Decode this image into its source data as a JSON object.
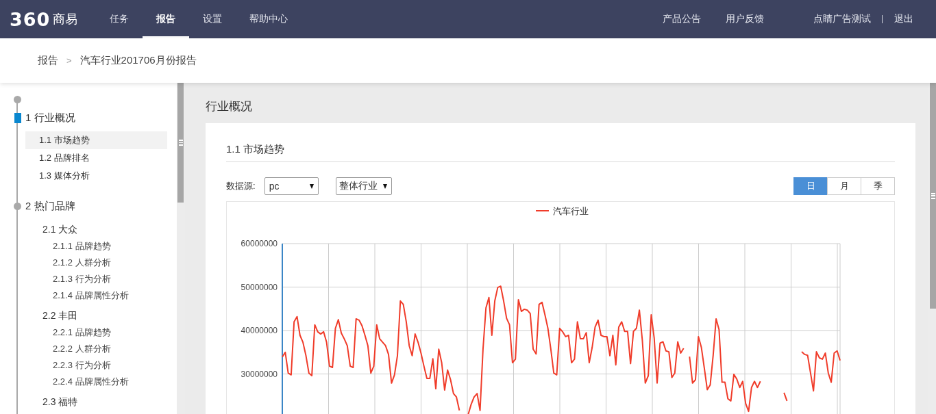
{
  "header": {
    "logo": {
      "mark": "360",
      "name": "商易"
    },
    "tabs": [
      {
        "label": "任务",
        "selected": false
      },
      {
        "label": "报告",
        "selected": true
      },
      {
        "label": "设置",
        "selected": false
      },
      {
        "label": "帮助中心",
        "selected": false
      }
    ],
    "links": [
      "产品公告",
      "用户反馈"
    ],
    "user": "点睛广告测试",
    "logout": "退出"
  },
  "breadcrumb": {
    "items": [
      "报告",
      "汽车行业201706月份报告"
    ],
    "separator": ">"
  },
  "outline": [
    {
      "label": "1 行业概况",
      "current": true,
      "children": [
        {
          "label": "1.1 市场趋势",
          "kind": "page",
          "selected": true
        },
        {
          "label": "1.2 品牌排名",
          "kind": "page",
          "selected": false
        },
        {
          "label": "1.3 媒体分析",
          "kind": "page",
          "selected": false
        }
      ]
    },
    {
      "label": "2 热门品牌",
      "current": false,
      "children": [
        {
          "label": "2.1 大众",
          "kind": "topic",
          "selected": false,
          "children": [
            {
              "label": "2.1.1 品牌趋势",
              "selected": false
            },
            {
              "label": "2.1.2 人群分析",
              "selected": false
            },
            {
              "label": "2.1.3 行为分析",
              "selected": false
            },
            {
              "label": "2.1.4 品牌属性分析",
              "selected": false
            }
          ]
        },
        {
          "label": "2.2 丰田",
          "kind": "topic",
          "selected": false,
          "children": [
            {
              "label": "2.2.1 品牌趋势",
              "selected": false
            },
            {
              "label": "2.2.2 人群分析",
              "selected": false
            },
            {
              "label": "2.2.3 行为分析",
              "selected": false
            },
            {
              "label": "2.2.4 品牌属性分析",
              "selected": false
            }
          ]
        },
        {
          "label": "2.3 福特",
          "kind": "topic",
          "selected": false
        }
      ]
    }
  ],
  "main": {
    "heading": "行业概况",
    "card": {
      "title": "1.1 市场趋势",
      "filters": {
        "label": "数据源:",
        "source": "pc",
        "scope": "整体行业"
      },
      "periods": [
        {
          "label": "日",
          "selected": true
        },
        {
          "label": "月",
          "selected": false
        },
        {
          "label": "季",
          "selected": false
        }
      ],
      "chart_data": {
        "type": "line",
        "grid": true,
        "ylim": [
          15000000,
          60000000
        ],
        "yticks": [
          30000000,
          40000000,
          50000000,
          60000000
        ],
        "categories": [
          null,
          null,
          null,
          null,
          null,
          null,
          null,
          null,
          null,
          null,
          null,
          null,
          null,
          null,
          null,
          null,
          null,
          null,
          null,
          null,
          null,
          null,
          null,
          null,
          null,
          null,
          null,
          null,
          null,
          null,
          null,
          null,
          null,
          null,
          null,
          null,
          null,
          null,
          null,
          null,
          null,
          null,
          null,
          null,
          null,
          null,
          null,
          null,
          null,
          null,
          null,
          null,
          null,
          null,
          null,
          null,
          null,
          null,
          null,
          null,
          null,
          null,
          null,
          null,
          null,
          null,
          null,
          null,
          null,
          null,
          null,
          null,
          null,
          null,
          null,
          null,
          null,
          null,
          null,
          null,
          null,
          null,
          null,
          null,
          null,
          null,
          null,
          null,
          null,
          null,
          null,
          null,
          null,
          null,
          null,
          null,
          null,
          null,
          null,
          null,
          null,
          null,
          null,
          null,
          null,
          null,
          null,
          null,
          null,
          null,
          null,
          null,
          null,
          null,
          null,
          null,
          null,
          null,
          null,
          null,
          null,
          null,
          null,
          null,
          null,
          null,
          null,
          null,
          null,
          null,
          null,
          null,
          null,
          null,
          null,
          null,
          null,
          null,
          null,
          null,
          null,
          null,
          null,
          null,
          null,
          null,
          null,
          null,
          null,
          null,
          null,
          null,
          null,
          null,
          null,
          null,
          null,
          null,
          null,
          null,
          null,
          null,
          null,
          null,
          null,
          null,
          null,
          null,
          null,
          null,
          null,
          null,
          null,
          null,
          null,
          null,
          null,
          null,
          null,
          null,
          null,
          null,
          null,
          null,
          null,
          null,
          null,
          null,
          null,
          null
        ],
        "series": [
          {
            "name": "汽车行业",
            "color": "#f03c2a",
            "values": [
              33900000,
              35000000,
              30200000,
              29800000,
              42000000,
              43200000,
              38900000,
              37300000,
              34200000,
              30200000,
              29600000,
              41300000,
              39700000,
              39200000,
              39700000,
              37300000,
              31800000,
              31500000,
              40500000,
              42500000,
              39400000,
              38100000,
              36500000,
              31800000,
              31500000,
              42700000,
              42400000,
              41100000,
              38900000,
              36500000,
              30200000,
              31800000,
              41300000,
              38100000,
              37300000,
              36500000,
              34500000,
              27900000,
              29800000,
              34200000,
              46800000,
              46000000,
              42000000,
              36500000,
              34200000,
              39200000,
              37300000,
              34800000,
              31800000,
              29000000,
              29000000,
              33500000,
              26600000,
              35700000,
              32600000,
              26300000,
              30900000,
              28700000,
              25500000,
              24700000,
              21600000,
              null,
              null,
              20700000,
              23000000,
              24700000,
              25500000,
              21600000,
              35700000,
              45200000,
              47600000,
              38900000,
              46800000,
              49900000,
              50200000,
              46800000,
              42800000,
              41300000,
              32600000,
              33400000,
              47100000,
              44400000,
              44900000,
              44700000,
              43900000,
              35700000,
              34600000,
              46000000,
              46500000,
              43600000,
              40500000,
              35700000,
              30200000,
              29800000,
              40500000,
              39700000,
              38600000,
              38900000,
              32600000,
              33400000,
              42000000,
              38100000,
              38100000,
              39500000,
              32600000,
              36100000,
              40800000,
              42400000,
              38900000,
              38600000,
              38600000,
              34200000,
              38900000,
              32100000,
              40800000,
              42000000,
              39800000,
              39800000,
              32400000,
              39800000,
              40500000,
              44700000,
              37800000,
              27900000,
              29600000,
              43600000,
              38300000,
              27900000,
              37100000,
              37400000,
              35300000,
              35100000,
              29200000,
              30200000,
              37400000,
              34800000,
              35900000,
              null,
              34000000,
              27900000,
              28700000,
              38600000,
              36100000,
              31300000,
              26400000,
              27500000,
              34300000,
              42700000,
              40200000,
              28100000,
              28100000,
              24300000,
              23800000,
              29900000,
              28800000,
              26900000,
              28300000,
              23200000,
              21400000,
              26900000,
              28300000,
              26900000,
              28300000,
              null,
              null,
              null,
              null,
              null,
              null,
              null,
              25700000,
              23800000,
              null,
              null,
              null,
              null,
              35100000,
              34500000,
              34300000,
              30200000,
              26100000,
              35100000,
              33700000,
              33400000,
              34800000,
              30200000,
              28100000,
              34800000,
              35300000,
              33100000
            ]
          }
        ]
      }
    }
  }
}
